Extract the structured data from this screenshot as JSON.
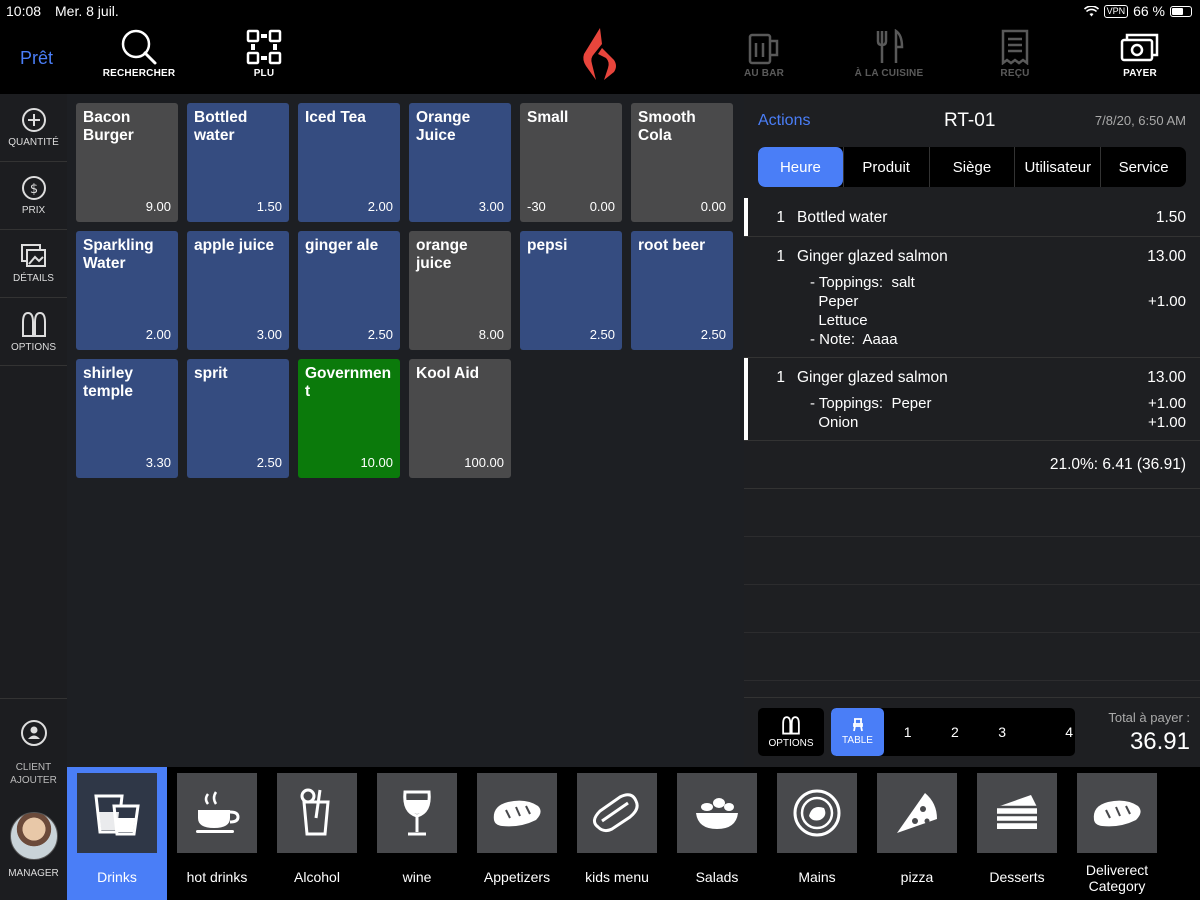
{
  "status": {
    "time": "10:08",
    "date": "Mer. 8 juil.",
    "vpn": "VPN",
    "battery": "66 %"
  },
  "topbar": {
    "ready": "Prêt",
    "search": "RECHERCHER",
    "plu": "PLU",
    "bar": "AU BAR",
    "kitchen": "À LA CUISINE",
    "receipt": "REÇU",
    "pay": "PAYER"
  },
  "sidebar": {
    "quantity": "QUANTITÉ",
    "price": "PRIX",
    "details": "DÉTAILS",
    "options": "OPTIONS",
    "client_line1": "CLIENT",
    "client_line2": "AJOUTER",
    "manager": "MANAGER"
  },
  "products": [
    {
      "name": "Bacon Burger",
      "price": "9.00",
      "color": "grey"
    },
    {
      "name": "Bottled water",
      "price": "1.50",
      "color": "blue"
    },
    {
      "name": "Iced Tea",
      "price": "2.00",
      "color": "blue"
    },
    {
      "name": "Orange Juice",
      "price": "3.00",
      "color": "blue"
    },
    {
      "name": "Small",
      "price": "0.00",
      "extra": "-30",
      "color": "grey"
    },
    {
      "name": "Smooth Cola",
      "price": "0.00",
      "color": "grey"
    },
    {
      "name": "Sparkling Water",
      "price": "2.00",
      "color": "blue"
    },
    {
      "name": "apple juice",
      "price": "3.00",
      "color": "blue"
    },
    {
      "name": "ginger ale",
      "price": "2.50",
      "color": "blue"
    },
    {
      "name": "orange juice",
      "price": "8.00",
      "color": "grey"
    },
    {
      "name": "pepsi",
      "price": "2.50",
      "color": "blue"
    },
    {
      "name": "root beer",
      "price": "2.50",
      "color": "blue"
    },
    {
      "name": "shirley temple",
      "price": "3.30",
      "color": "blue"
    },
    {
      "name": "sprit",
      "price": "2.50",
      "color": "blue"
    },
    {
      "name": "Government",
      "price": "10.00",
      "color": "green"
    },
    {
      "name": "Kool Aid",
      "price": "100.00",
      "color": "grey"
    }
  ],
  "order": {
    "actions": "Actions",
    "table": "RT-01",
    "date": "7/8/20, 6:50 AM",
    "sort_tabs": [
      "Heure",
      "Produit",
      "Siège",
      "Utilisateur",
      "Service"
    ],
    "items": {
      "i0": {
        "qty": "1",
        "name": "Bottled water",
        "amount": "1.50"
      },
      "i1": {
        "qty": "1",
        "name": "Ginger glazed salmon",
        "amount": "13.00",
        "m0": "- Toppings:  salt",
        "m1": "  Peper",
        "m1_amt": "+1.00",
        "m2": "  Lettuce",
        "m3": "- Note:  Aaaa"
      },
      "i2": {
        "qty": "1",
        "name": "Ginger glazed salmon",
        "amount": "13.00",
        "m0": "- Toppings:  Peper",
        "m0_amt": "+1.00",
        "m1": "  Onion",
        "m1_amt": "+1.00"
      }
    },
    "tax_line": "21.0%: 6.41 (36.91)",
    "footer": {
      "options": "OPTIONS",
      "table": "TABLE",
      "seats": [
        "1",
        "2",
        "3",
        "4"
      ],
      "total_label": "Total à payer :",
      "total_value": "36.91"
    }
  },
  "categories": [
    {
      "label": "Drinks",
      "icon": "drinks-icon"
    },
    {
      "label": "hot drinks",
      "icon": "coffee-cup-icon"
    },
    {
      "label": "Alcohol",
      "icon": "cocktail-icon"
    },
    {
      "label": "wine",
      "icon": "wine-glass-icon"
    },
    {
      "label": "Appetizers",
      "icon": "bread-icon"
    },
    {
      "label": "kids menu",
      "icon": "hotdog-icon"
    },
    {
      "label": "Salads",
      "icon": "salad-bowl-icon"
    },
    {
      "label": "Mains",
      "icon": "plate-icon"
    },
    {
      "label": "pizza",
      "icon": "pizza-slice-icon"
    },
    {
      "label": "Desserts",
      "icon": "cake-slice-icon"
    },
    {
      "label": "Deliverect Category",
      "icon": "bread-icon"
    }
  ],
  "colors": {
    "accent": "#4a7ef7",
    "tile_blue": "#354c80",
    "tile_grey": "#4a4a4b",
    "tile_green": "#0b7a0b",
    "logo": "#e8453c"
  }
}
